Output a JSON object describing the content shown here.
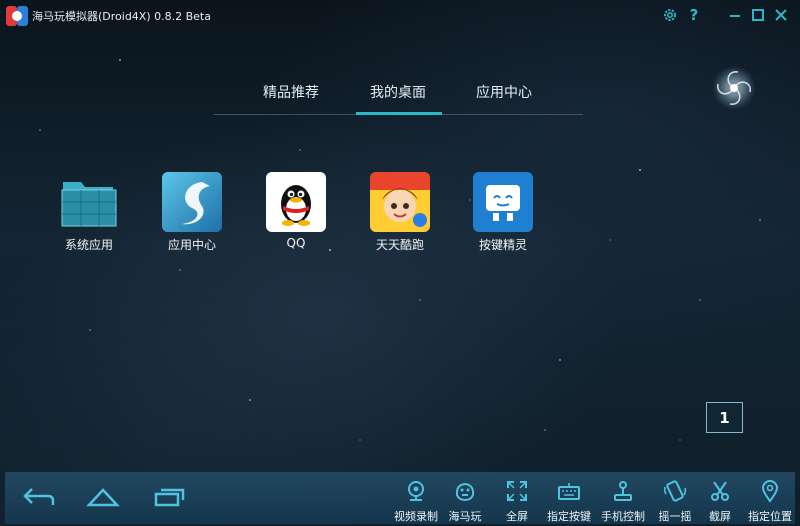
{
  "titlebar": {
    "title": "海马玩模拟器(Droid4X) 0.8.2 Beta",
    "icons": [
      "gear-icon",
      "help-icon",
      "minimize-icon",
      "maximize-icon",
      "close-icon"
    ]
  },
  "tabs": [
    {
      "label": "精品推荐",
      "active": false
    },
    {
      "label": "我的桌面",
      "active": true
    },
    {
      "label": "应用中心",
      "active": false
    }
  ],
  "apps": [
    {
      "label": "系统应用",
      "icon": "folder-icon"
    },
    {
      "label": "应用中心",
      "icon": "app-center-icon"
    },
    {
      "label": "QQ",
      "icon": "qq-penguin-icon"
    },
    {
      "label": "天天酷跑",
      "icon": "game-avatar-icon"
    },
    {
      "label": "按键精灵",
      "icon": "robot-icon"
    }
  ],
  "page_indicator": "1",
  "nav": [
    "back-icon",
    "home-icon",
    "recent-apps-icon"
  ],
  "toolbar": [
    {
      "label": "视频录制",
      "icon": "webcam-icon"
    },
    {
      "label": "海马玩",
      "icon": "hippo-icon"
    },
    {
      "label": "全屏",
      "icon": "fullscreen-icon"
    },
    {
      "label": "指定按键",
      "icon": "keyboard-icon"
    },
    {
      "label": "手机控制",
      "icon": "joystick-icon"
    },
    {
      "label": "摇一摇",
      "icon": "shake-icon"
    },
    {
      "label": "截屏",
      "icon": "scissors-icon"
    },
    {
      "label": "指定位置",
      "icon": "location-pin-icon"
    }
  ],
  "colors": {
    "accent": "#2bb7c9",
    "bottombar": "#1e4a66"
  }
}
